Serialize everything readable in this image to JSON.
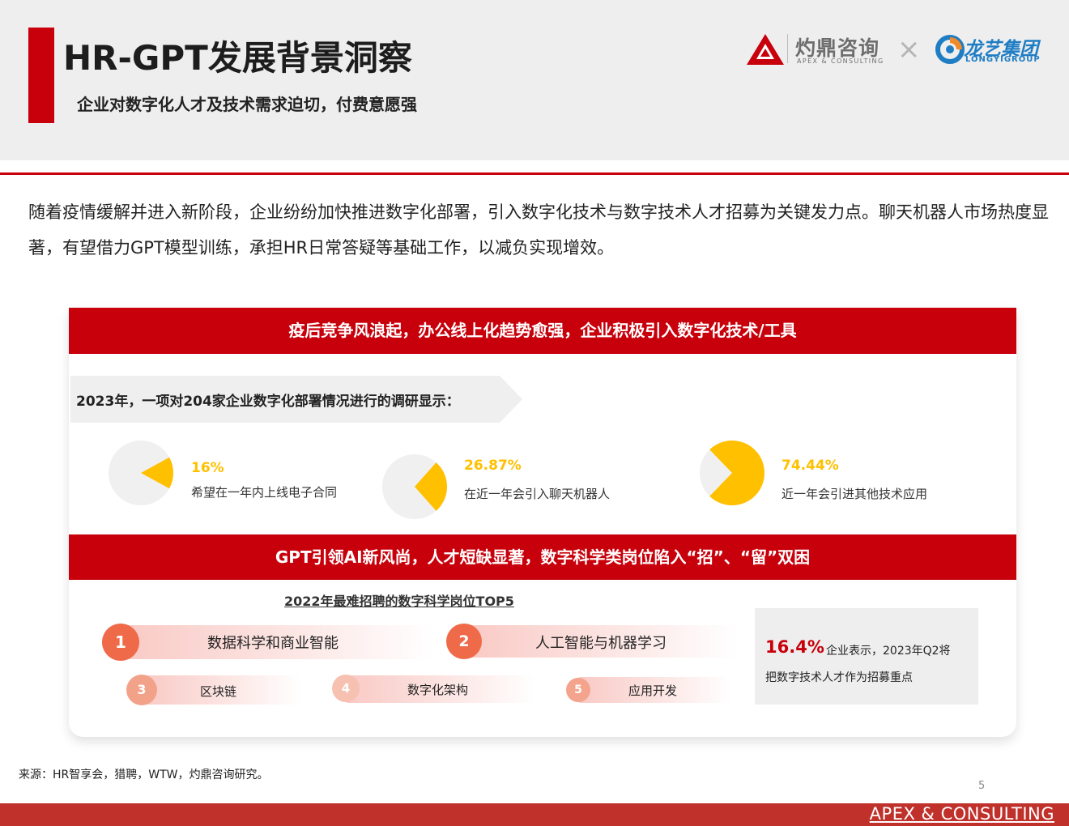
{
  "header": {
    "title": "HR-GPT发展背景洞察",
    "subtitle": "企业对数字化人才及技术需求迫切，付费意愿强"
  },
  "logos": {
    "apex_cn": "灼鼎咨询",
    "apex_en": "APEX & CONSULTING",
    "times": "×",
    "longyi_cn": "龙艺集团",
    "longyi_en": "LONGYIGROUP"
  },
  "intro": "随着疫情缓解并进入新阶段，企业纷纷加快推进数字化部署，引入数字化技术与数字技术人才招募为关键发力点。聊天机器人市场热度显著，有望借力GPT模型训练，承担HR日常答疑等基础工作，以减负实现增效。",
  "section1": {
    "heading": "疫后竞争风浪起，办公线上化趋势愈强，企业积极引入数字化技术/工具",
    "survey_intro": "2023年，一项对204家企业数字化部署情况进行的调研显示：",
    "stats": [
      {
        "value_label": "16%",
        "fraction": 0.16,
        "label": "希望在一年内上线电子合同"
      },
      {
        "value_label": "26.87%",
        "fraction": 0.2687,
        "label": "在近一年会引入聊天机器人"
      },
      {
        "value_label": "74.44%",
        "fraction": 0.7444,
        "label": "近一年会引进其他技术应用"
      }
    ]
  },
  "section2": {
    "heading": "GPT引领AI新风尚，人才短缺显著，数字科学类岗位陷入“招”、“留”双困",
    "top5_title": "2022年最难招聘的数字科学岗位TOP5",
    "positions": [
      {
        "rank": "1",
        "label": "数据科学和商业智能"
      },
      {
        "rank": "2",
        "label": "人工智能与机器学习"
      },
      {
        "rank": "3",
        "label": "区块链"
      },
      {
        "rank": "4",
        "label": "数字化架构"
      },
      {
        "rank": "5",
        "label": "应用开发"
      }
    ],
    "note": {
      "percent": "16.4%",
      "line1": "企业表示，2023年Q2将",
      "line2": "把数字技术人才作为招募重点"
    }
  },
  "source": "来源：HR智享会，猎聘，WTW，灼鼎咨询研究。",
  "page_number": "5",
  "footer_brand": "APEX & CONSULTING",
  "colors": {
    "brand_red": "#c8000b",
    "accent_yellow": "#ffc000",
    "pie_base": "#f0f0f0",
    "rank_circles": [
      "#ef6a48",
      "#ef6a48",
      "#f3a28a",
      "#f6c1b1",
      "#f4a48d"
    ]
  }
}
